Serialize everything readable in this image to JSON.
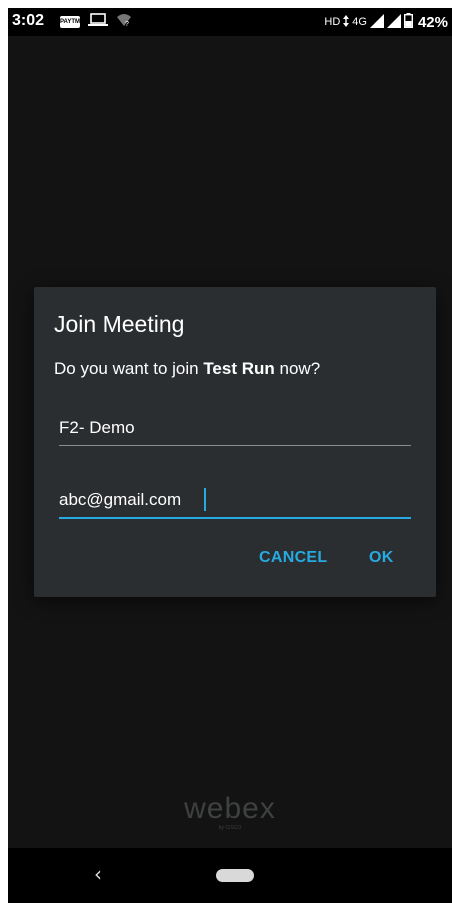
{
  "status_bar": {
    "time": "3:02",
    "paytm_label": "PAYTM",
    "left_icons": [
      "paytm-icon",
      "laptop-icon",
      "wifi-question-icon"
    ],
    "hd_label": "HD",
    "network_label": "4G",
    "battery_percent": "42%"
  },
  "dialog": {
    "title": "Join Meeting",
    "message_prefix": "Do you want to join ",
    "meeting_name": "Test Run",
    "message_suffix": " now?",
    "name_field_value": "F2- Demo",
    "email_field_value": "abc@gmail.com",
    "cancel_label": "CANCEL",
    "ok_label": "OK"
  },
  "brand": {
    "logo_text": "webex",
    "logo_subtext": "by CISCO"
  },
  "nav_bar": {
    "back_symbol": "‹"
  },
  "colors": {
    "accent": "#27a9e1",
    "dialog_bg": "#2b2e31",
    "screen_bg": "#131313"
  }
}
